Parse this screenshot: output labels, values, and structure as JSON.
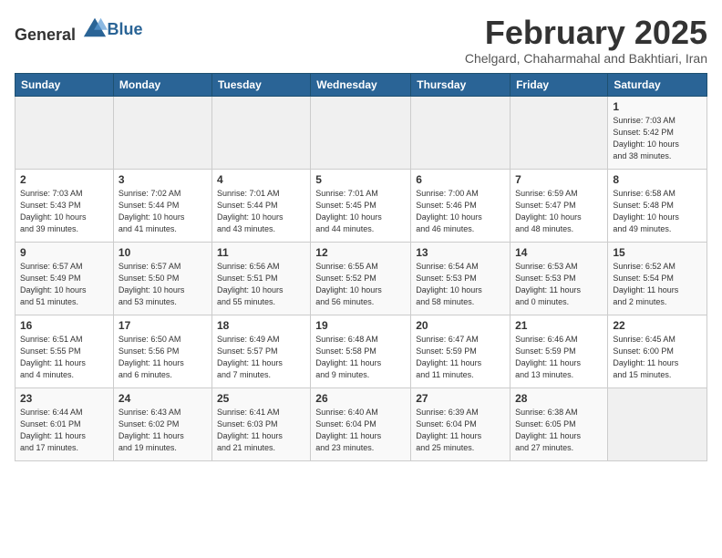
{
  "logo": {
    "general": "General",
    "blue": "Blue"
  },
  "header": {
    "month": "February 2025",
    "location": "Chelgard, Chaharmahal and Bakhtiari, Iran"
  },
  "weekdays": [
    "Sunday",
    "Monday",
    "Tuesday",
    "Wednesday",
    "Thursday",
    "Friday",
    "Saturday"
  ],
  "weeks": [
    [
      {
        "day": "",
        "info": ""
      },
      {
        "day": "",
        "info": ""
      },
      {
        "day": "",
        "info": ""
      },
      {
        "day": "",
        "info": ""
      },
      {
        "day": "",
        "info": ""
      },
      {
        "day": "",
        "info": ""
      },
      {
        "day": "1",
        "info": "Sunrise: 7:03 AM\nSunset: 5:42 PM\nDaylight: 10 hours\nand 38 minutes."
      }
    ],
    [
      {
        "day": "2",
        "info": "Sunrise: 7:03 AM\nSunset: 5:43 PM\nDaylight: 10 hours\nand 39 minutes."
      },
      {
        "day": "3",
        "info": "Sunrise: 7:02 AM\nSunset: 5:44 PM\nDaylight: 10 hours\nand 41 minutes."
      },
      {
        "day": "4",
        "info": "Sunrise: 7:01 AM\nSunset: 5:44 PM\nDaylight: 10 hours\nand 43 minutes."
      },
      {
        "day": "5",
        "info": "Sunrise: 7:01 AM\nSunset: 5:45 PM\nDaylight: 10 hours\nand 44 minutes."
      },
      {
        "day": "6",
        "info": "Sunrise: 7:00 AM\nSunset: 5:46 PM\nDaylight: 10 hours\nand 46 minutes."
      },
      {
        "day": "7",
        "info": "Sunrise: 6:59 AM\nSunset: 5:47 PM\nDaylight: 10 hours\nand 48 minutes."
      },
      {
        "day": "8",
        "info": "Sunrise: 6:58 AM\nSunset: 5:48 PM\nDaylight: 10 hours\nand 49 minutes."
      }
    ],
    [
      {
        "day": "9",
        "info": "Sunrise: 6:57 AM\nSunset: 5:49 PM\nDaylight: 10 hours\nand 51 minutes."
      },
      {
        "day": "10",
        "info": "Sunrise: 6:57 AM\nSunset: 5:50 PM\nDaylight: 10 hours\nand 53 minutes."
      },
      {
        "day": "11",
        "info": "Sunrise: 6:56 AM\nSunset: 5:51 PM\nDaylight: 10 hours\nand 55 minutes."
      },
      {
        "day": "12",
        "info": "Sunrise: 6:55 AM\nSunset: 5:52 PM\nDaylight: 10 hours\nand 56 minutes."
      },
      {
        "day": "13",
        "info": "Sunrise: 6:54 AM\nSunset: 5:53 PM\nDaylight: 10 hours\nand 58 minutes."
      },
      {
        "day": "14",
        "info": "Sunrise: 6:53 AM\nSunset: 5:53 PM\nDaylight: 11 hours\nand 0 minutes."
      },
      {
        "day": "15",
        "info": "Sunrise: 6:52 AM\nSunset: 5:54 PM\nDaylight: 11 hours\nand 2 minutes."
      }
    ],
    [
      {
        "day": "16",
        "info": "Sunrise: 6:51 AM\nSunset: 5:55 PM\nDaylight: 11 hours\nand 4 minutes."
      },
      {
        "day": "17",
        "info": "Sunrise: 6:50 AM\nSunset: 5:56 PM\nDaylight: 11 hours\nand 6 minutes."
      },
      {
        "day": "18",
        "info": "Sunrise: 6:49 AM\nSunset: 5:57 PM\nDaylight: 11 hours\nand 7 minutes."
      },
      {
        "day": "19",
        "info": "Sunrise: 6:48 AM\nSunset: 5:58 PM\nDaylight: 11 hours\nand 9 minutes."
      },
      {
        "day": "20",
        "info": "Sunrise: 6:47 AM\nSunset: 5:59 PM\nDaylight: 11 hours\nand 11 minutes."
      },
      {
        "day": "21",
        "info": "Sunrise: 6:46 AM\nSunset: 5:59 PM\nDaylight: 11 hours\nand 13 minutes."
      },
      {
        "day": "22",
        "info": "Sunrise: 6:45 AM\nSunset: 6:00 PM\nDaylight: 11 hours\nand 15 minutes."
      }
    ],
    [
      {
        "day": "23",
        "info": "Sunrise: 6:44 AM\nSunset: 6:01 PM\nDaylight: 11 hours\nand 17 minutes."
      },
      {
        "day": "24",
        "info": "Sunrise: 6:43 AM\nSunset: 6:02 PM\nDaylight: 11 hours\nand 19 minutes."
      },
      {
        "day": "25",
        "info": "Sunrise: 6:41 AM\nSunset: 6:03 PM\nDaylight: 11 hours\nand 21 minutes."
      },
      {
        "day": "26",
        "info": "Sunrise: 6:40 AM\nSunset: 6:04 PM\nDaylight: 11 hours\nand 23 minutes."
      },
      {
        "day": "27",
        "info": "Sunrise: 6:39 AM\nSunset: 6:04 PM\nDaylight: 11 hours\nand 25 minutes."
      },
      {
        "day": "28",
        "info": "Sunrise: 6:38 AM\nSunset: 6:05 PM\nDaylight: 11 hours\nand 27 minutes."
      },
      {
        "day": "",
        "info": ""
      }
    ]
  ]
}
